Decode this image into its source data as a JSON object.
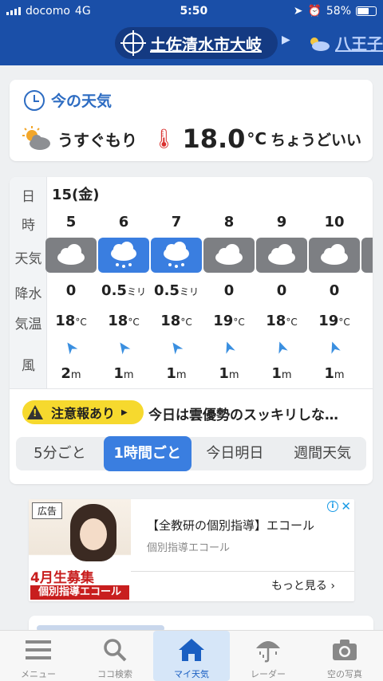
{
  "status_bar": {
    "carrier": "docomo",
    "network": "4G",
    "time": "5:50",
    "battery": "58%",
    "battery_level": 0.58
  },
  "header": {
    "location": "土佐清水市大岐",
    "next_location": "八王子"
  },
  "current": {
    "title": "今の天気",
    "condition": "うすぐもり",
    "temperature": "18.0",
    "unit": "°C",
    "feel": "ちょうどいい"
  },
  "hourly": {
    "row_labels": {
      "day": "日",
      "hour": "時",
      "weather": "天気",
      "precip": "降水",
      "temp": "気温",
      "wind": "風"
    },
    "date": "15(金)",
    "hours": [
      {
        "hour": "5",
        "weather": "cloudy",
        "precip": "0",
        "precip_unit": "",
        "temp": "18",
        "temp_unit": "°C",
        "wind": "2",
        "wind_unit": "m"
      },
      {
        "hour": "6",
        "weather": "rain",
        "precip": "0.5",
        "precip_unit": "ミリ",
        "temp": "18",
        "temp_unit": "°C",
        "wind": "1",
        "wind_unit": "m"
      },
      {
        "hour": "7",
        "weather": "rain",
        "precip": "0.5",
        "precip_unit": "ミリ",
        "temp": "18",
        "temp_unit": "°C",
        "wind": "1",
        "wind_unit": "m"
      },
      {
        "hour": "8",
        "weather": "cloudy",
        "precip": "0",
        "precip_unit": "",
        "temp": "19",
        "temp_unit": "°C",
        "wind": "1",
        "wind_unit": "m"
      },
      {
        "hour": "9",
        "weather": "cloudy",
        "precip": "0",
        "precip_unit": "",
        "temp": "18",
        "temp_unit": "°C",
        "wind": "1",
        "wind_unit": "m"
      },
      {
        "hour": "10",
        "weather": "cloudy",
        "precip": "0",
        "precip_unit": "",
        "temp": "19",
        "temp_unit": "°C",
        "wind": "1",
        "wind_unit": "m"
      }
    ],
    "colors": {
      "cloudy": "#7d7f83",
      "rain": "#3a7ee0"
    }
  },
  "warning": {
    "badge": "注意報あり",
    "text": "今日は雲優勢のスッキリしな…"
  },
  "segments": [
    "5分ごと",
    "1時間ごと",
    "今日明日",
    "週間天気"
  ],
  "active_segment": "1時間ごと",
  "ad": {
    "label": "広告",
    "title": "【全教研の個別指導】エコール",
    "sub": "個別指導エコール",
    "more": "もっと見る",
    "banner_big": "4月生募集",
    "banner_red": "個別指導エコール"
  },
  "tabs": [
    {
      "label": "メニュー",
      "icon": "menu-icon"
    },
    {
      "label": "ココ検索",
      "icon": "search-icon"
    },
    {
      "label": "マイ天気",
      "icon": "home-icon"
    },
    {
      "label": "レーダー",
      "icon": "radar-icon"
    },
    {
      "label": "空の写真",
      "icon": "camera-icon"
    }
  ]
}
